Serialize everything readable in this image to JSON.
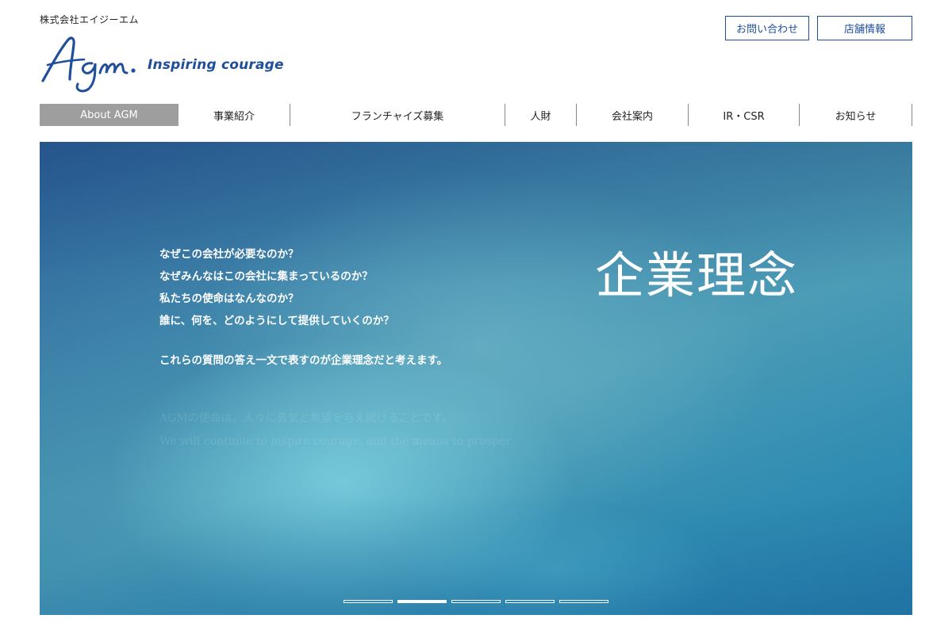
{
  "header": {
    "company_name": "株式会社エイジーエム",
    "logo_text": "Agm.",
    "tagline": "Inspiring courage",
    "buttons": [
      {
        "label": "お問い合わせ"
      },
      {
        "label": "店舗情報"
      }
    ]
  },
  "nav": {
    "items": [
      {
        "label": "About AGM",
        "active": true
      },
      {
        "label": "事業紹介"
      },
      {
        "label": "フランチャイズ募集"
      },
      {
        "label": "人財"
      },
      {
        "label": "会社案内"
      },
      {
        "label": "IR・CSR"
      },
      {
        "label": "お知らせ"
      }
    ]
  },
  "hero": {
    "title": "企業理念",
    "lines": [
      "なぜこの会社が必要なのか？",
      "なぜみんなはこの会社に集まっているのか？",
      "私たちの使命はなんなのか？",
      "誰に、何を、どのようにして提供していくのか？"
    ],
    "summary": "これらの質問の答え一文で表すのが企業理念だと考えます。",
    "faded_jp": "AGMの使命は、人々に勇気と希望を与え続けることです。",
    "faded_en": "We will continue to inspire courage, and the means to prosper.",
    "slides": [
      {
        "active": false
      },
      {
        "active": true
      },
      {
        "active": false
      },
      {
        "active": false
      },
      {
        "active": false
      }
    ]
  },
  "colors": {
    "brand": "#1f4e9a",
    "nav_active_bg": "#9e9e9e",
    "hero_base": "#3f85ab"
  }
}
